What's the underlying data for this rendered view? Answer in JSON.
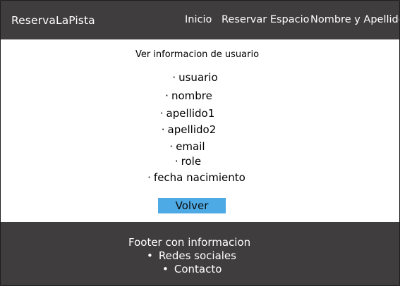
{
  "header": {
    "brand": "ReservaLaPista",
    "nav": [
      {
        "label": "Inicio"
      },
      {
        "label": "Reservar Espacio"
      },
      {
        "label": "Nombre y Apellido"
      }
    ]
  },
  "main": {
    "title": "Ver informacion de usuario",
    "bullet": "·",
    "fields": [
      {
        "label": "usuario"
      },
      {
        "label": "nombre"
      },
      {
        "label": "apellido1"
      },
      {
        "label": "apellido2"
      },
      {
        "label": "email"
      },
      {
        "label": "role"
      },
      {
        "label": "fecha nacimiento"
      }
    ],
    "back_label": "Volver"
  },
  "footer": {
    "title": "Footer con informacion",
    "bullet": "•",
    "items": [
      {
        "label": "Redes sociales"
      },
      {
        "label": "Contacto"
      }
    ]
  },
  "colors": {
    "header_bg": "#3f3d3d",
    "content_bg": "#ffffff",
    "button_bg": "#4eaae4",
    "footer_bg": "#3f3d3d"
  }
}
